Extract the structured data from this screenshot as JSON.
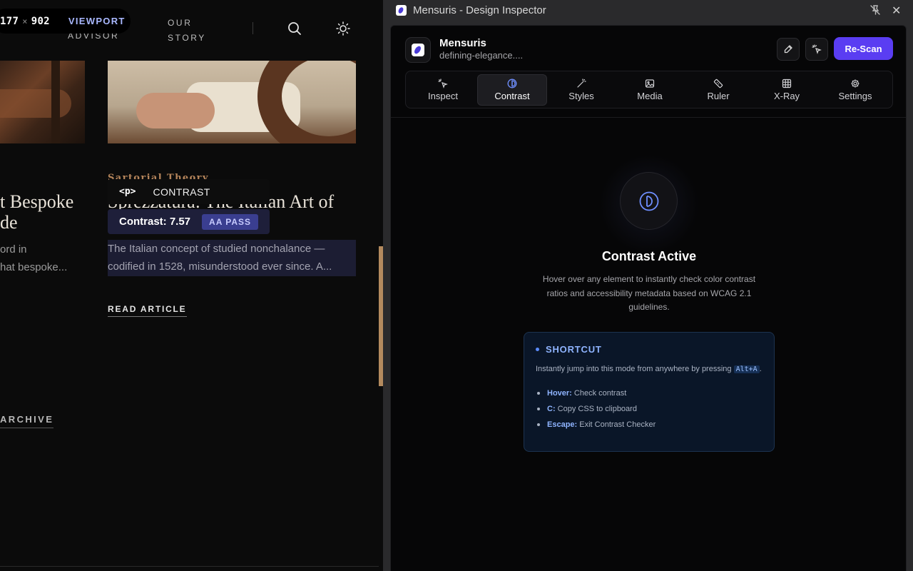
{
  "site": {
    "viewport": {
      "width": "177",
      "height": "902",
      "label": "VIEWPORT"
    },
    "nav": {
      "advisor": "ADVISOR",
      "our_story": "OUR STORY"
    },
    "icons": {
      "search": "search-icon",
      "theme": "sun-icon"
    },
    "kicker": "Sartorial Theory",
    "article_left": {
      "title": "t Bespoke\nde",
      "excerpt": "ord in\nhat bespoke..."
    },
    "article_right": {
      "title": "Sprezzatura: The Italian Art of",
      "excerpt_line1": "The Italian concept of studied nonchalance —",
      "excerpt_line2": "codified in 1528, misunderstood ever since. A...",
      "read_label": "READ ARTICLE"
    },
    "archive_label": "ARCHIVE",
    "tooltip": {
      "tag": "<p>",
      "mode": "CONTRAST",
      "ratio": "Contrast: 7.57",
      "badge": "AA PASS"
    }
  },
  "window": {
    "title": "Mensuris - Design Inspector",
    "close": "✕"
  },
  "panel": {
    "app_name": "Mensuris",
    "url": "defining-elegance....",
    "rescan_label": "Re-Scan",
    "tabs": [
      {
        "label": "Inspect",
        "icon": "cursor-sparkle-icon"
      },
      {
        "label": "Contrast",
        "icon": "contrast-icon"
      },
      {
        "label": "Styles",
        "icon": "wand-icon"
      },
      {
        "label": "Media",
        "icon": "image-icon"
      },
      {
        "label": "Ruler",
        "icon": "ruler-icon"
      },
      {
        "label": "X-Ray",
        "icon": "grid-icon"
      },
      {
        "label": "Settings",
        "icon": "gear-icon"
      }
    ],
    "active_tab": "Contrast",
    "hero": {
      "title": "Contrast Active",
      "description": "Hover over any element to instantly check color contrast ratios and accessibility metadata based on WCAG 2.1 guidelines."
    },
    "shortcut": {
      "title": "SHORTCUT",
      "text_before": "Instantly jump into this mode from anywhere by pressing",
      "key": "Alt+A",
      "text_after": ".",
      "items": [
        {
          "key": "Hover:",
          "desc": "Check contrast"
        },
        {
          "key": "C:",
          "desc": "Copy CSS to clipboard"
        },
        {
          "key": "Escape:",
          "desc": "Exit Contrast Checker"
        }
      ]
    }
  },
  "colors": {
    "accent": "#5a3df2",
    "highlight": "#1c1d33",
    "shortcut_text": "#8fb4ff",
    "page_bg": "#0b0b0b"
  }
}
